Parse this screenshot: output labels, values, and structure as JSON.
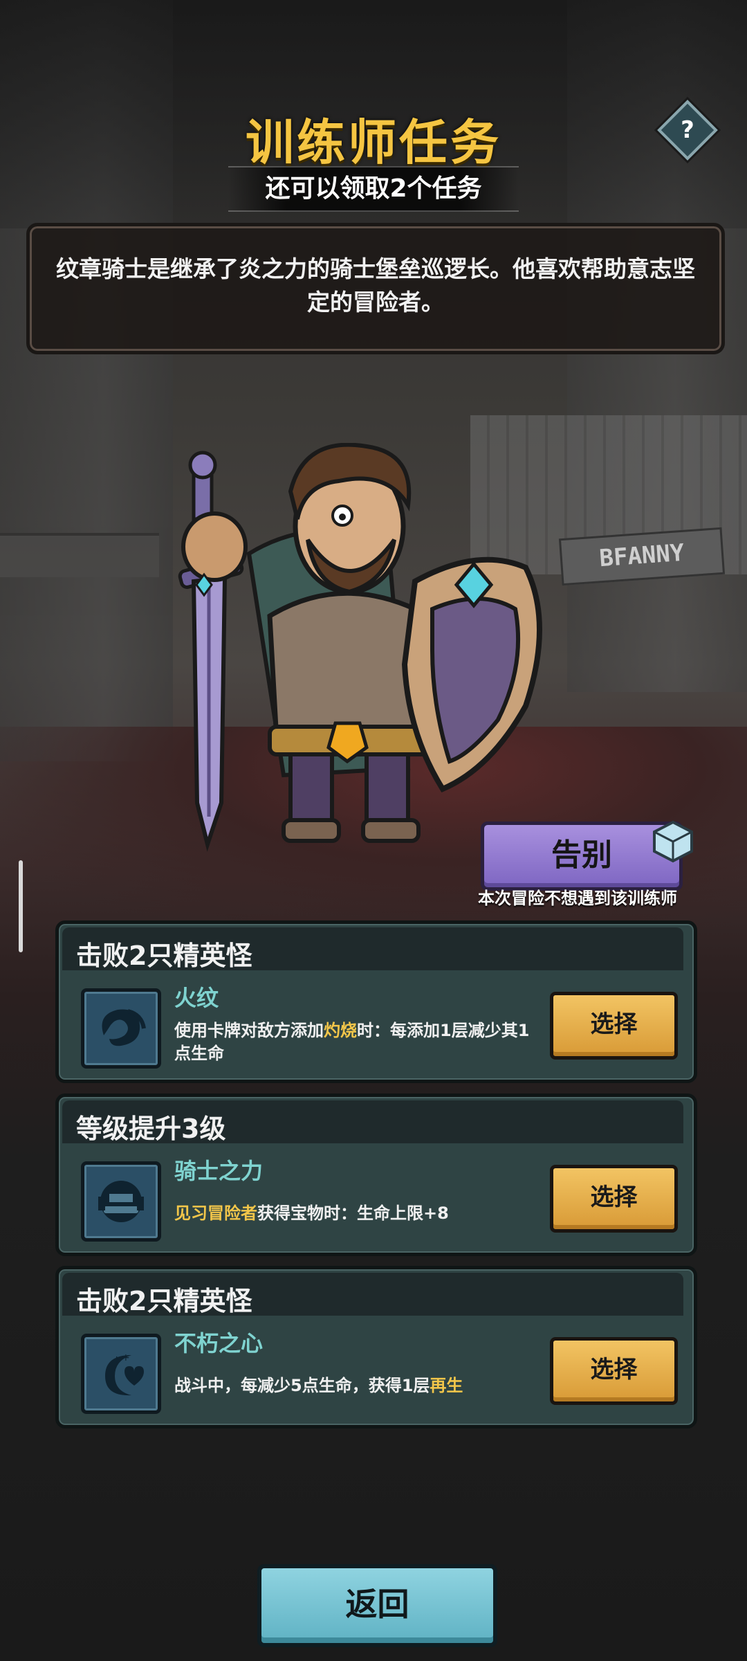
{
  "header": {
    "title": "训练师任务",
    "subtitle": "还可以领取2个任务",
    "help_icon": "?"
  },
  "background_sign": "BFANNY",
  "description": "纹章骑士是继承了炎之力的骑士堡垒巡逻长。他喜欢帮助意志坚定的冒险者。",
  "farewell": {
    "label": "告别",
    "caption": "本次冒险不想遇到该训练师"
  },
  "quests": [
    {
      "header": "击败2只精英怪",
      "icon": "flame-swirl-icon",
      "name": "火纹",
      "desc_parts": [
        "使用卡牌对敌方添加",
        "灼烧",
        "时：每添加1层减少其1点生命"
      ],
      "button": "选择"
    },
    {
      "header": "等级提升3级",
      "icon": "knight-helmet-icon",
      "name": "骑士之力",
      "desc_parts": [
        "",
        "见习冒险者",
        "获得宝物时：生命上限+8"
      ],
      "button": "选择"
    },
    {
      "header": "击败2只精英怪",
      "icon": "heart-moon-icon",
      "name": "不朽之心",
      "desc_parts": [
        "战斗中，每减少5点生命，获得1层",
        "再生",
        ""
      ],
      "button": "选择"
    }
  ],
  "back_button": "返回",
  "colors": {
    "title": "#f5c542",
    "highlight": "#f3c64a",
    "skill_name": "#7fd3d0",
    "select_button": "#f2c463",
    "farewell_button": "#a890de",
    "back_button": "#8fd3e0"
  }
}
